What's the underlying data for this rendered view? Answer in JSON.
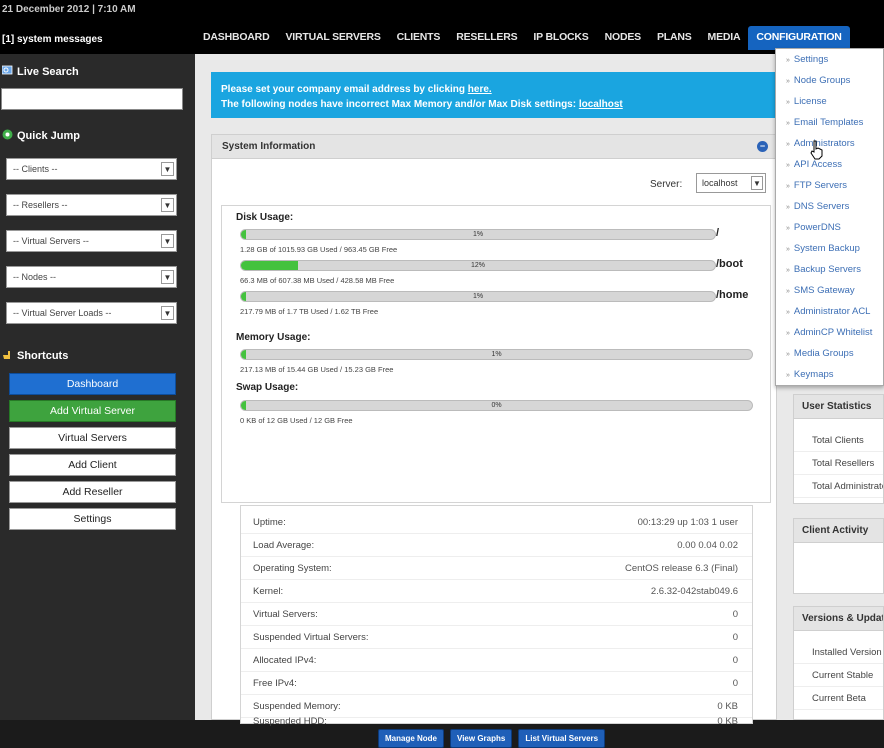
{
  "header": {
    "datetime": "21 December 2012 | 7:10 AM",
    "system_messages": "[1] system messages"
  },
  "nav": {
    "tabs": [
      "DASHBOARD",
      "VIRTUAL SERVERS",
      "CLIENTS",
      "RESELLERS",
      "IP BLOCKS",
      "NODES",
      "PLANS",
      "MEDIA",
      "CONFIGURATION"
    ],
    "active": "CONFIGURATION"
  },
  "sidebar": {
    "live_search": "Live Search",
    "quick_jump": "Quick Jump",
    "selects": [
      "-- Clients --",
      "-- Resellers --",
      "-- Virtual Servers --",
      "-- Nodes --",
      "-- Virtual Server Loads --"
    ],
    "shortcuts": "Shortcuts",
    "buttons": [
      "Dashboard",
      "Add Virtual Server",
      "Virtual Servers",
      "Add Client",
      "Add Reseller",
      "Settings"
    ]
  },
  "alert": {
    "line1_prefix": "Please set your company email address by clicking ",
    "line1_link": "here.",
    "line2_prefix": "The following nodes have incorrect Max Memory and/or Max Disk settings: ",
    "line2_link": "localhost"
  },
  "system_info": {
    "title": "System Information",
    "server_label": "Server:",
    "server_value": "localhost",
    "disk_label": "Disk Usage:",
    "disks": [
      {
        "mount": "/",
        "percent": 1,
        "pct_text": "1%",
        "text": "1.28 GB of 1015.93 GB Used / 963.45 GB Free"
      },
      {
        "mount": "/boot",
        "percent": 12,
        "pct_text": "12%",
        "text": "66.3 MB of 607.38 MB Used / 428.58 MB Free"
      },
      {
        "mount": "/home",
        "percent": 1,
        "pct_text": "1%",
        "text": "217.79 MB of 1.7 TB Used / 1.62 TB Free"
      }
    ],
    "memory_label": "Memory Usage:",
    "memory": {
      "percent": 1,
      "pct_text": "1%",
      "text": "217.13 MB of 15.44 GB Used / 15.23 GB Free"
    },
    "swap_label": "Swap Usage:",
    "swap": {
      "percent": 0,
      "pct_text": "0%",
      "text": "0 KB of 12 GB Used / 12 GB Free"
    },
    "stats": [
      {
        "k": "Uptime:",
        "v": "00:13:29 up 1:03 1 user"
      },
      {
        "k": "Load Average:",
        "v": "0.00 0.04 0.02"
      },
      {
        "k": "Operating System:",
        "v": "CentOS release 6.3 (Final)"
      },
      {
        "k": "Kernel:",
        "v": "2.6.32-042stab049.6"
      },
      {
        "k": "Virtual Servers:",
        "v": "0"
      },
      {
        "k": "Suspended Virtual Servers:",
        "v": "0"
      },
      {
        "k": "Allocated IPv4:",
        "v": "0"
      },
      {
        "k": "Free IPv4:",
        "v": "0"
      },
      {
        "k": "Suspended Memory:",
        "v": "0 KB"
      },
      {
        "k": "Suspended HDD:",
        "v": "0 KB"
      }
    ],
    "buttons": [
      "Manage Node",
      "View Graphs",
      "List Virtual Servers"
    ]
  },
  "right_panel": {
    "user_stats_title": "User Statistics",
    "user_stats_items": [
      "Total Clients",
      "Total Resellers",
      "Total Administrators"
    ],
    "client_activity_title": "Client Activity",
    "versions_title": "Versions & Updates",
    "versions_items": [
      "Installed Version",
      "Current Stable",
      "Current Beta"
    ]
  },
  "config_menu": {
    "items": [
      "Settings",
      "Node Groups",
      "License",
      "Email Templates",
      "Administrators",
      "API Access",
      "FTP Servers",
      "DNS Servers",
      "PowerDNS",
      "System Backup",
      "Backup Servers",
      "SMS Gateway",
      "Administrator ACL",
      "AdminCP Whitelist",
      "Media Groups",
      "Keymaps"
    ]
  }
}
